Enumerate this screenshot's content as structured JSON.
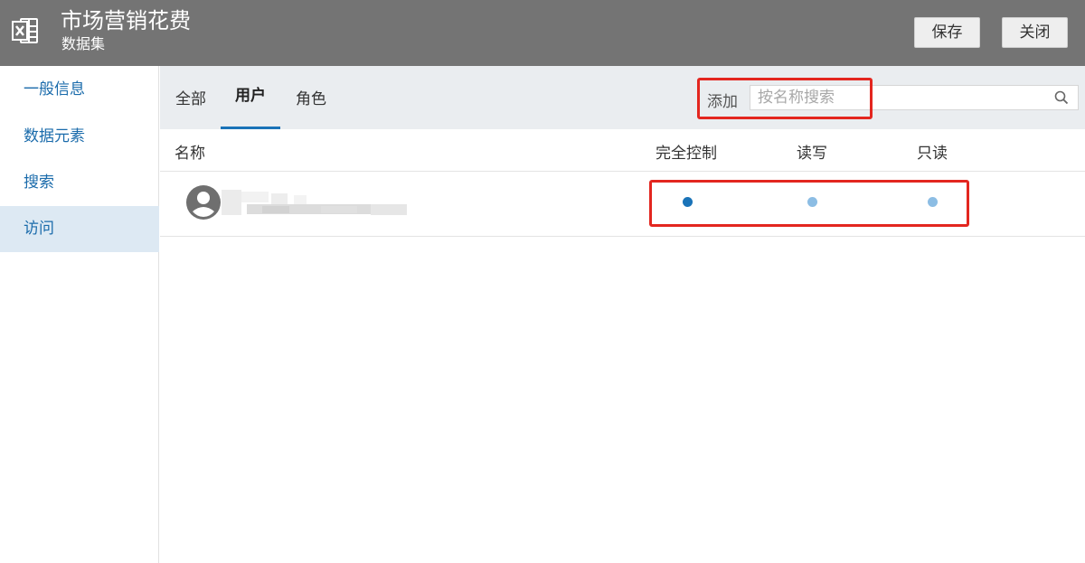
{
  "header": {
    "title": "市场营销花费",
    "subtitle": "数据集",
    "save_label": "保存",
    "close_label": "关闭",
    "file_icon": "excel-file-icon"
  },
  "sidebar": {
    "items": [
      {
        "label": "一般信息",
        "active": false
      },
      {
        "label": "数据元素",
        "active": false
      },
      {
        "label": "搜索",
        "active": false
      },
      {
        "label": "访问",
        "active": true
      }
    ]
  },
  "tabs": {
    "items": [
      {
        "label": "全部",
        "active": false
      },
      {
        "label": "用户",
        "active": true
      },
      {
        "label": "角色",
        "active": false
      }
    ]
  },
  "search": {
    "add_label": "添加",
    "placeholder": "按名称搜索",
    "value": "",
    "icon": "search-icon"
  },
  "table": {
    "columns": [
      "名称",
      "完全控制",
      "读写",
      "只读"
    ],
    "rows": [
      {
        "avatar": "user-avatar-icon",
        "name_redacted": true,
        "permission_selected": "完全控制"
      }
    ]
  },
  "colors": {
    "header_bg": "#747474",
    "accent": "#1a73b8",
    "radio_selected": "#1a73b8",
    "radio_unselected": "#8cbde4",
    "highlight_box": "#e3261f",
    "sidebar_active_bg": "#dde9f3"
  }
}
